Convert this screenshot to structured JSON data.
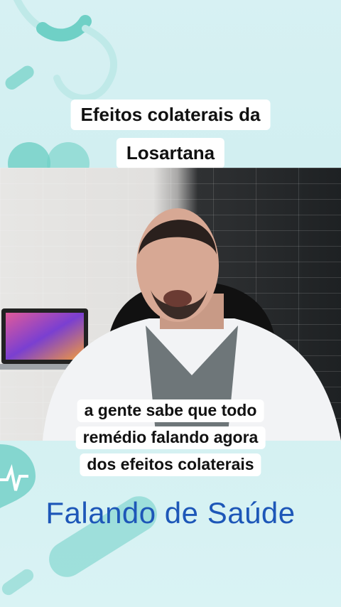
{
  "title_lines": [
    "Efeitos colaterais da",
    "Losartana"
  ],
  "caption_lines": [
    "a gente sabe que todo",
    "remédio falando agora",
    "dos efeitos colaterais"
  ],
  "brand": "Falando de Saúde",
  "colors": {
    "background": "#d7f1f3",
    "brand_text": "#1d57b8",
    "accent_teal": "#6fd0c6"
  },
  "icons": [
    "stethoscope-icon",
    "pill-icon",
    "heart-pulse-icon",
    "laptop-icon",
    "office-chair-icon",
    "doctor-figure"
  ]
}
